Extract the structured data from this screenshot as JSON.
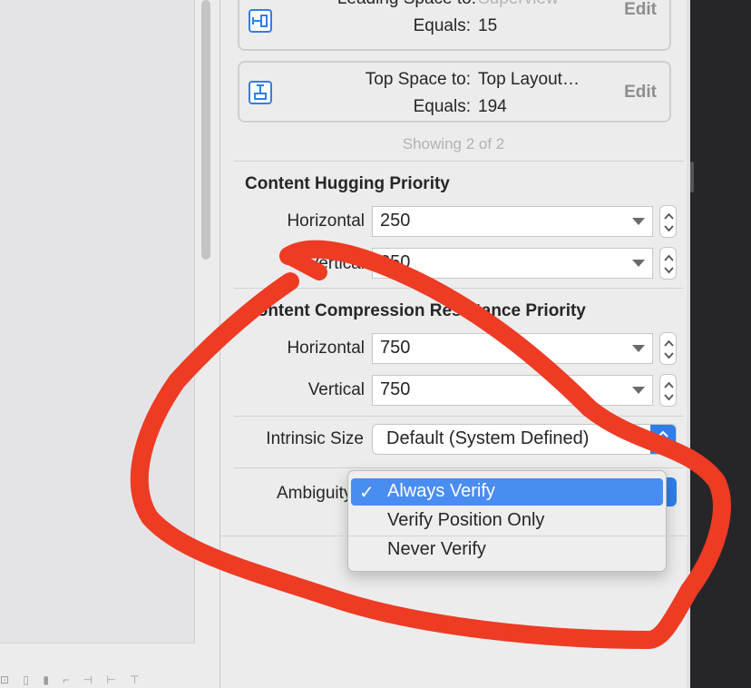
{
  "canvas": {
    "bottom_toolbar_glyphs": "⊡ ▯ ▮ ⌐ ⊣ ⊢ ⊤"
  },
  "constraints": [
    {
      "label": "Leading Space to:",
      "value": "Superview",
      "equals_label": "Equals:",
      "equals_value": "15",
      "edit_label": "Edit",
      "icon": "leading-space-constraint-icon"
    },
    {
      "label": "Top Space to:",
      "value": "Top Layout…",
      "equals_label": "Equals:",
      "equals_value": "194",
      "edit_label": "Edit",
      "icon": "top-space-constraint-icon"
    }
  ],
  "showing_count": "Showing 2 of 2",
  "hugging": {
    "title": "Content Hugging Priority",
    "horizontal_label": "Horizontal",
    "horizontal_value": "250",
    "vertical_label": "Vertical",
    "vertical_value": "250"
  },
  "compression": {
    "title": "Content Compression Resistance Priority",
    "horizontal_label": "Horizontal",
    "horizontal_value": "750",
    "vertical_label": "Vertical",
    "vertical_value": "750"
  },
  "intrinsic_size": {
    "label": "Intrinsic Size",
    "value": "Default (System Defined)"
  },
  "ambiguity": {
    "label": "Ambiguity",
    "options": [
      "Always Verify",
      "Verify Position Only",
      "Never Verify"
    ],
    "selected": "Always Verify",
    "checkmark": "✓"
  },
  "colors": {
    "accent": "#2f7fe8",
    "menu_highlight": "#4a8df0",
    "annotation": "#ee3b24"
  }
}
